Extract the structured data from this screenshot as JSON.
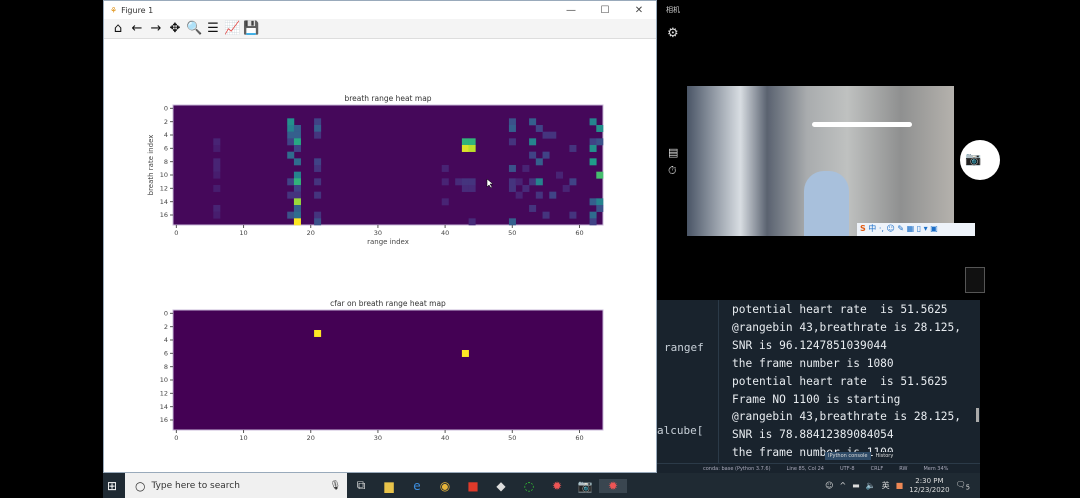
{
  "figure_window": {
    "title": "Figure 1",
    "minimize": "—",
    "maximize": "☐",
    "close": "✕",
    "toolbar": [
      {
        "name": "home-icon",
        "glyph": "⌂"
      },
      {
        "name": "back-icon",
        "glyph": "←"
      },
      {
        "name": "forward-icon",
        "glyph": "→"
      },
      {
        "name": "pan-icon",
        "glyph": "✥"
      },
      {
        "name": "zoom-icon",
        "glyph": "🔍"
      },
      {
        "name": "subplots-icon",
        "glyph": "☰"
      },
      {
        "name": "edit-axis-icon",
        "glyph": "📈"
      },
      {
        "name": "save-icon",
        "glyph": "💾"
      }
    ]
  },
  "chart_data": [
    {
      "type": "heatmap",
      "title": "breath range heat map",
      "xlabel": "range index",
      "ylabel": "breath rate index",
      "cols": 64,
      "rows": 18,
      "xticks": [
        0,
        10,
        20,
        30,
        40,
        50,
        60
      ],
      "yticks": [
        0,
        2,
        4,
        6,
        8,
        10,
        12,
        14,
        16
      ],
      "colormap": "viridis",
      "background_value": 0.02,
      "cells": [
        [
          17,
          2,
          0.5
        ],
        [
          17,
          3,
          0.45
        ],
        [
          17,
          4,
          0.3
        ],
        [
          17,
          5,
          0.2
        ],
        [
          17,
          7,
          0.35
        ],
        [
          17,
          11,
          0.2
        ],
        [
          17,
          13,
          0.15
        ],
        [
          17,
          16,
          0.25
        ],
        [
          18,
          3,
          0.3
        ],
        [
          18,
          4,
          0.3
        ],
        [
          18,
          5,
          0.6
        ],
        [
          18,
          6,
          0.2
        ],
        [
          18,
          8,
          0.35
        ],
        [
          18,
          10,
          0.45
        ],
        [
          18,
          11,
          0.65
        ],
        [
          18,
          12,
          0.2
        ],
        [
          18,
          13,
          0.15
        ],
        [
          18,
          14,
          0.85
        ],
        [
          18,
          15,
          0.3
        ],
        [
          18,
          16,
          0.35
        ],
        [
          18,
          17,
          1.0
        ],
        [
          21,
          2,
          0.2
        ],
        [
          21,
          3,
          0.3
        ],
        [
          21,
          4,
          0.15
        ],
        [
          21,
          8,
          0.2
        ],
        [
          21,
          9,
          0.15
        ],
        [
          21,
          11,
          0.15
        ],
        [
          21,
          13,
          0.15
        ],
        [
          21,
          16,
          0.15
        ],
        [
          21,
          17,
          0.25
        ],
        [
          6,
          5,
          0.1
        ],
        [
          6,
          6,
          0.08
        ],
        [
          6,
          8,
          0.1
        ],
        [
          6,
          9,
          0.1
        ],
        [
          6,
          10,
          0.08
        ],
        [
          6,
          12,
          0.08
        ],
        [
          6,
          15,
          0.1
        ],
        [
          6,
          16,
          0.08
        ],
        [
          43,
          5,
          0.65
        ],
        [
          43,
          6,
          0.95
        ],
        [
          44,
          5,
          0.65
        ],
        [
          44,
          6,
          0.9
        ],
        [
          42,
          11,
          0.12
        ],
        [
          43,
          11,
          0.15
        ],
        [
          44,
          11,
          0.15
        ],
        [
          43,
          12,
          0.12
        ],
        [
          44,
          12,
          0.12
        ],
        [
          40,
          9,
          0.1
        ],
        [
          40,
          11,
          0.1
        ],
        [
          40,
          14,
          0.1
        ],
        [
          44,
          17,
          0.12
        ],
        [
          50,
          2,
          0.25
        ],
        [
          50,
          3,
          0.3
        ],
        [
          50,
          5,
          0.15
        ],
        [
          50,
          9,
          0.25
        ],
        [
          50,
          11,
          0.15
        ],
        [
          50,
          12,
          0.15
        ],
        [
          50,
          17,
          0.3
        ],
        [
          51,
          11,
          0.1
        ],
        [
          51,
          13,
          0.1
        ],
        [
          52,
          9,
          0.1
        ],
        [
          52,
          12,
          0.12
        ],
        [
          53,
          2,
          0.3
        ],
        [
          53,
          5,
          0.45
        ],
        [
          53,
          7,
          0.2
        ],
        [
          53,
          11,
          0.15
        ],
        [
          53,
          15,
          0.15
        ],
        [
          54,
          3,
          0.2
        ],
        [
          54,
          8,
          0.3
        ],
        [
          54,
          11,
          0.45
        ],
        [
          54,
          13,
          0.15
        ],
        [
          55,
          4,
          0.15
        ],
        [
          55,
          7,
          0.2
        ],
        [
          55,
          16,
          0.15
        ],
        [
          56,
          4,
          0.15
        ],
        [
          56,
          13,
          0.2
        ],
        [
          57,
          10,
          0.1
        ],
        [
          58,
          12,
          0.1
        ],
        [
          59,
          6,
          0.15
        ],
        [
          59,
          11,
          0.2
        ],
        [
          59,
          16,
          0.15
        ],
        [
          62,
          2,
          0.45
        ],
        [
          62,
          5,
          0.2
        ],
        [
          62,
          6,
          0.5
        ],
        [
          62,
          8,
          0.55
        ],
        [
          62,
          14,
          0.3
        ],
        [
          62,
          16,
          0.35
        ],
        [
          62,
          17,
          0.2
        ],
        [
          63,
          3,
          0.5
        ],
        [
          63,
          5,
          0.25
        ],
        [
          63,
          10,
          0.7
        ],
        [
          63,
          14,
          0.45
        ],
        [
          63,
          15,
          0.25
        ]
      ]
    },
    {
      "type": "heatmap",
      "title": "cfar on breath range heat map",
      "xlabel": "",
      "ylabel": "",
      "cols": 64,
      "rows": 18,
      "xticks": [
        0,
        10,
        20,
        30,
        40,
        50,
        60
      ],
      "yticks": [
        0,
        2,
        4,
        6,
        8,
        10,
        12,
        14,
        16
      ],
      "colormap": "viridis",
      "background_value": 0.0,
      "cells": [
        [
          21,
          3,
          1.0
        ],
        [
          43,
          6,
          1.0
        ]
      ]
    }
  ],
  "camera": {
    "title": "相机"
  },
  "console": {
    "editor_fragments": [
      "rangef",
      "alcube["
    ],
    "lines": [
      "potential heart rate  is 51.5625",
      "@rangebin 43,breathrate is 28.125,",
      "SNR is 96.1247851039044",
      "the frame number is 1080",
      "potential heart rate  is 51.5625",
      "Frame NO 1100 is starting",
      "@rangebin 43,breathrate is 28.125,",
      "SNR is 78.88412389084054",
      "the frame number is 1100",
      "potential heart rate  is 51.5625"
    ],
    "tabs": [
      "IPython console",
      "History"
    ]
  },
  "status_bar": [
    "conda: base (Python 3.7.6)",
    "Line 85, Col 24",
    "UTF-8",
    "CRLF",
    "RW",
    "Mem 34%"
  ],
  "taskbar": {
    "search_placeholder": "Type here to search",
    "time": "2:30 PM",
    "date": "12/23/2020",
    "notifications": "5",
    "ime": "英"
  }
}
